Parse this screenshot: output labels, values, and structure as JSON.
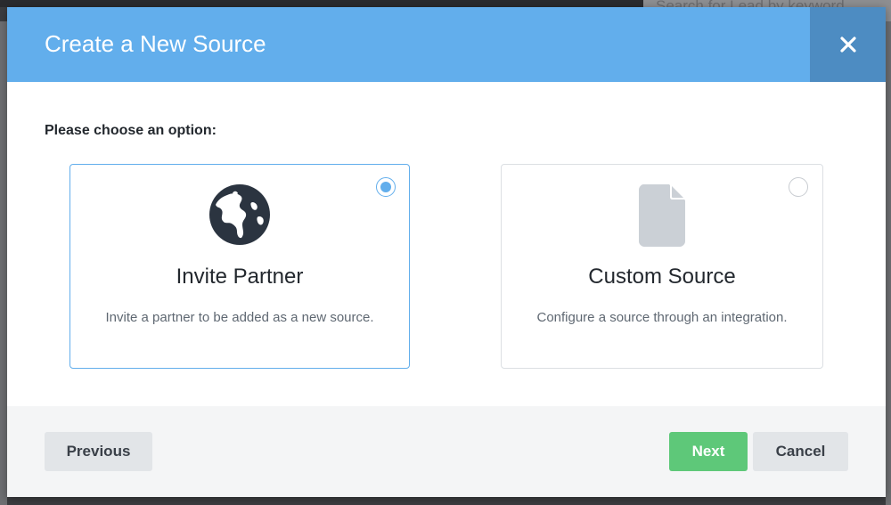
{
  "background": {
    "search_placeholder": "Search for Lead by keyword"
  },
  "modal": {
    "title": "Create a New Source",
    "close_icon": "close-icon",
    "prompt": "Please choose an option:",
    "options": [
      {
        "title": "Invite Partner",
        "description": "Invite a partner to be added as a new source.",
        "icon": "globe-icon",
        "selected": true
      },
      {
        "title": "Custom Source",
        "description": "Configure a source through an integration.",
        "icon": "document-icon",
        "selected": false
      }
    ],
    "footer": {
      "previous_label": "Previous",
      "next_label": "Next",
      "cancel_label": "Cancel"
    }
  },
  "colors": {
    "header": "#62aeec",
    "close_bg": "#4d8cc2",
    "next_button": "#5ec879",
    "selected_border": "#62aeec"
  }
}
